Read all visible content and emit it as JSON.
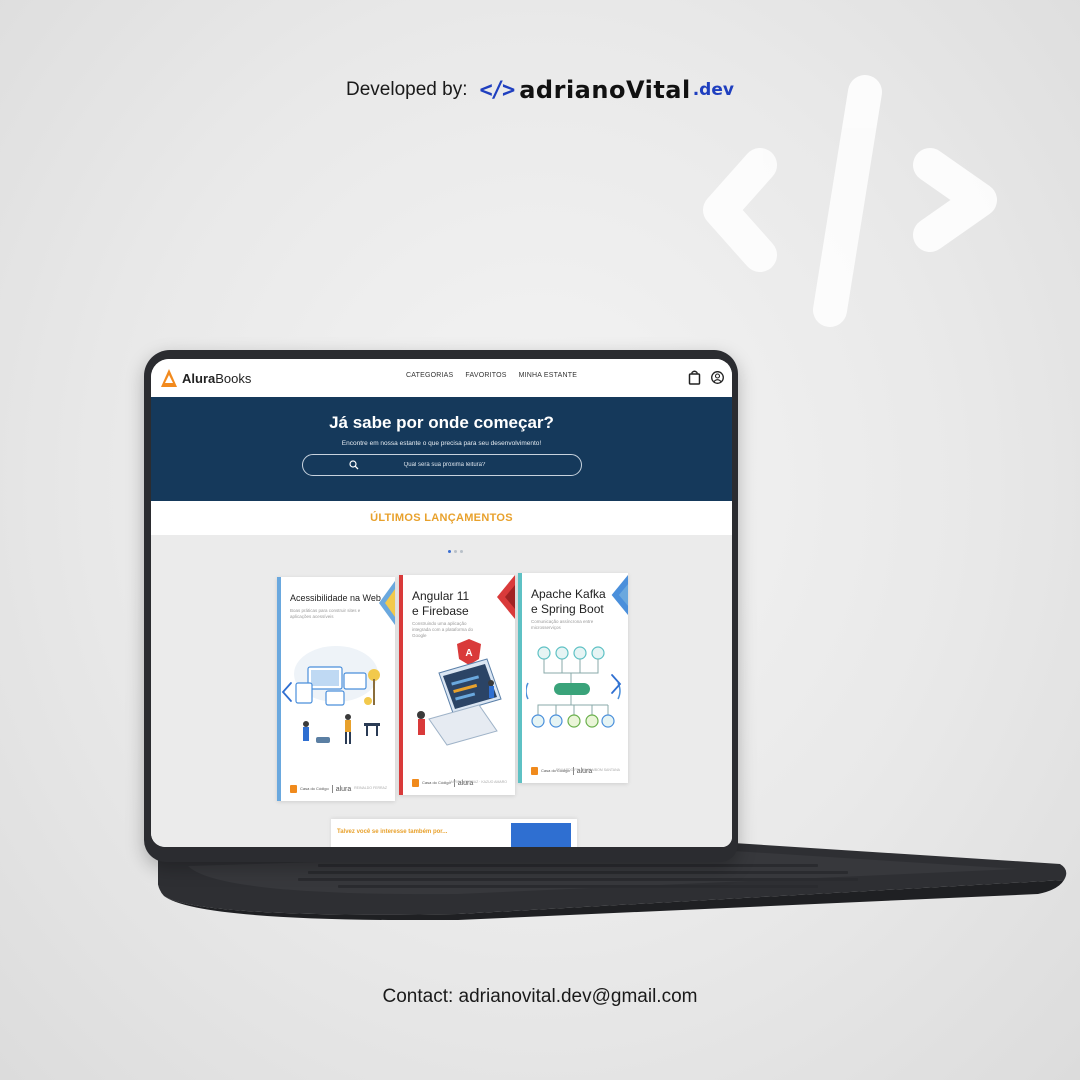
{
  "credit": {
    "label": "Developed by:",
    "brand_icon": "</>",
    "brand_name": "adrianoVital",
    "brand_tld": ".dev"
  },
  "site": {
    "logo_text_bold": "Alura",
    "logo_text_rest": "Books",
    "nav": [
      "CATEGORIAS",
      "FAVORITOS",
      "MINHA ESTANTE"
    ],
    "icons": [
      "shopping-bag-icon",
      "user-icon"
    ]
  },
  "hero": {
    "title": "Já sabe por onde começar?",
    "subtitle": "Encontre em nossa estante o que precisa para seu desenvolvimento!",
    "search_placeholder": "Qual será sua próxima leitura?"
  },
  "launches": {
    "title": "ÚLTIMOS LANÇAMENTOS",
    "books": [
      {
        "title": "Acessibilidade na Web",
        "subtitle": "Boas práticas para construir sites e aplicações acessíveis",
        "author": "REINALDO FERRAZ",
        "spine_color": "#6aa8de"
      },
      {
        "title": "Angular 11 e Firebase",
        "subtitle": "Construindo uma aplicação integrada com a plataforma do Google",
        "author": "MARCIO FERRAZ · KAZUO AMARO",
        "spine_color": "#d93a3a"
      },
      {
        "title": "Apache Kafka e Spring Boot",
        "subtitle": "Comunicação assíncrona entre microsserviços",
        "author": "EDUARDO FELIPE ZAMBOM SANTANA",
        "spine_color": "#5ec1c4"
      }
    ],
    "publisher": {
      "name": "alura",
      "mark_text": "Casa do Código"
    },
    "accent_color": "#e8a12c"
  },
  "suggest": {
    "label": "Talvez você se interesse também por..."
  },
  "contact": {
    "text": "Contact: adrianovital.dev@gmail.com"
  },
  "colors": {
    "hero_bg": "#15395b",
    "brand_blue": "#1f3fbf",
    "laptop": "#2b2c30"
  }
}
